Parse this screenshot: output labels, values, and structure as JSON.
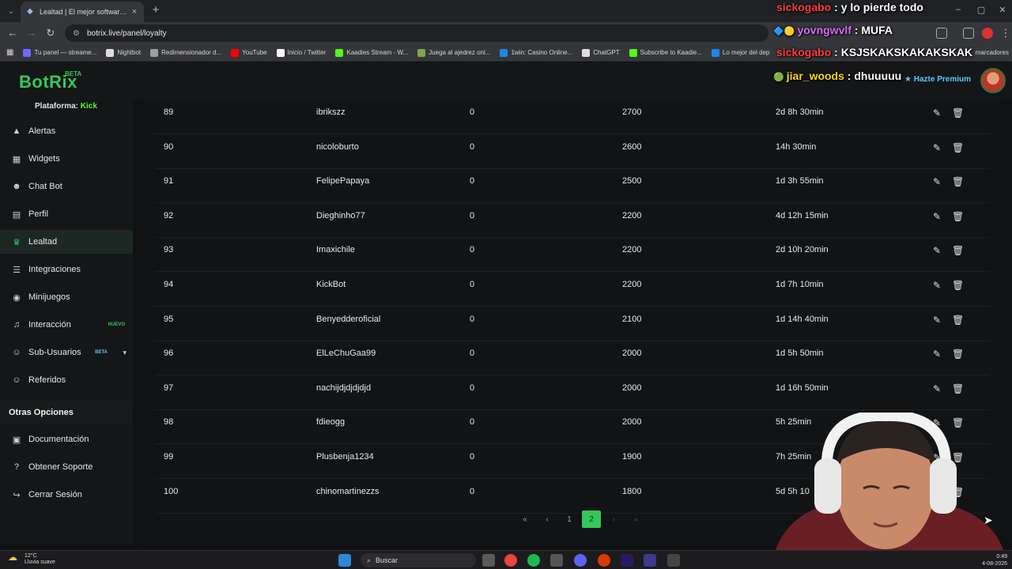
{
  "browser": {
    "tab_title": "Lealtad | El mejor software para",
    "url": "botrix.live/panel/loyalty",
    "bookmarks": [
      {
        "label": "Tu panel — streame...",
        "color": "#6b6bff"
      },
      {
        "label": "Nightbot",
        "color": "#dddddd"
      },
      {
        "label": "Redimensionador d...",
        "color": "#9aa0a6"
      },
      {
        "label": "YouTube",
        "color": "#ff0000"
      },
      {
        "label": "Inicio / Twitter",
        "color": "#ffffff"
      },
      {
        "label": "Kaadies Stream - W...",
        "color": "#53fc18"
      },
      {
        "label": "Juega al ajedrez onl...",
        "color": "#7fa650"
      },
      {
        "label": "1win: Casino Online...",
        "color": "#1e88e5"
      },
      {
        "label": "ChatGPT",
        "color": "#dddddd"
      },
      {
        "label": "Subscribe to Kaadie...",
        "color": "#53fc18"
      },
      {
        "label": "Lo mejor del dep",
        "color": "#1e88e5"
      }
    ],
    "bookmarks_overflow": "marcadores"
  },
  "app": {
    "logo": "BotRix",
    "logo_badge": "BETA",
    "premium_label": "Hazte Premium",
    "platform_label": "Plataforma:",
    "platform_value": "Kick",
    "sidebar_items": [
      {
        "label": "Alertas",
        "icon": "warning-icon",
        "glyph": "▲"
      },
      {
        "label": "Widgets",
        "icon": "grid-icon",
        "glyph": "▦"
      },
      {
        "label": "Chat Bot",
        "icon": "robot-icon",
        "glyph": "☻"
      },
      {
        "label": "Perfil",
        "icon": "id-card-icon",
        "glyph": "▤"
      },
      {
        "label": "Lealtad",
        "icon": "trophy-icon",
        "glyph": "♛",
        "active": true
      },
      {
        "label": "Integraciones",
        "icon": "list-icon",
        "glyph": "☰"
      },
      {
        "label": "Minijuegos",
        "icon": "gamepad-icon",
        "glyph": "◉"
      },
      {
        "label": "Interacción",
        "icon": "music-icon",
        "glyph": "♫",
        "tag": "NUEVO",
        "tag_color": "#34c759"
      },
      {
        "label": "Sub-Usuarios",
        "icon": "users-icon",
        "glyph": "☺",
        "tag": "BETA",
        "tag_color": "#5ac8fa",
        "expandable": true
      },
      {
        "label": "Referidos",
        "icon": "user-group-icon",
        "glyph": "☺"
      }
    ],
    "other_options_title": "Otras Opciones",
    "other_items": [
      {
        "label": "Documentación",
        "icon": "book-icon",
        "glyph": "▣"
      },
      {
        "label": "Obtener Soporte",
        "icon": "support-icon",
        "glyph": "?"
      },
      {
        "label": "Cerrar Sesión",
        "icon": "logout-icon",
        "glyph": "↪"
      }
    ]
  },
  "table": {
    "rows": [
      {
        "rank": "89",
        "user": "ibrikszz",
        "col3": "0",
        "points": "2700",
        "watchtime": "2d 8h 30min"
      },
      {
        "rank": "90",
        "user": "nicoloburto",
        "col3": "0",
        "points": "2600",
        "watchtime": "14h 30min"
      },
      {
        "rank": "91",
        "user": "FelipePapaya",
        "col3": "0",
        "points": "2500",
        "watchtime": "1d 3h 55min"
      },
      {
        "rank": "92",
        "user": "Dieghinho77",
        "col3": "0",
        "points": "2200",
        "watchtime": "4d 12h 15min"
      },
      {
        "rank": "93",
        "user": "Imaxichile",
        "col3": "0",
        "points": "2200",
        "watchtime": "2d 10h 20min"
      },
      {
        "rank": "94",
        "user": "KickBot",
        "col3": "0",
        "points": "2200",
        "watchtime": "1d 7h 10min"
      },
      {
        "rank": "95",
        "user": "Benyedderoficial",
        "col3": "0",
        "points": "2100",
        "watchtime": "1d 14h 40min"
      },
      {
        "rank": "96",
        "user": "ElLeChuGaa99",
        "col3": "0",
        "points": "2000",
        "watchtime": "1d 5h 50min"
      },
      {
        "rank": "97",
        "user": "nachijdjdjdjdjd",
        "col3": "0",
        "points": "2000",
        "watchtime": "1d 16h 50min"
      },
      {
        "rank": "98",
        "user": "fdieogg",
        "col3": "0",
        "points": "2000",
        "watchtime": "5h 25min"
      },
      {
        "rank": "99",
        "user": "Plusbenja1234",
        "col3": "0",
        "points": "1900",
        "watchtime": "7h 25min"
      },
      {
        "rank": "100",
        "user": "chinomartinezzs",
        "col3": "0",
        "points": "1800",
        "watchtime": "5d 5h 10"
      }
    ]
  },
  "pagination": {
    "first": "«",
    "prev": "‹",
    "pages": [
      "1",
      "2"
    ],
    "current": "2",
    "next": "›",
    "last": "»"
  },
  "chat_overlay": [
    {
      "user": "sickogabo",
      "msg": "y lo pierde todo",
      "user_color": "#ff3b3b"
    },
    {
      "user": "yovngwvlf",
      "msg": "MUFA",
      "user_color": "#d66bff"
    },
    {
      "user": "sickogabo",
      "msg": "KSJSKAKSKAKAKSKAK",
      "user_color": "#ff3b3b"
    },
    {
      "user": "jiar_woods",
      "msg": "dhuuuuu",
      "user_color": "#ffd60a"
    }
  ],
  "taskbar": {
    "weather_temp": "12°C",
    "weather_desc": "Lluvia suave",
    "search_label": "Buscar",
    "time": "0:49",
    "date": "4-08-2026"
  }
}
